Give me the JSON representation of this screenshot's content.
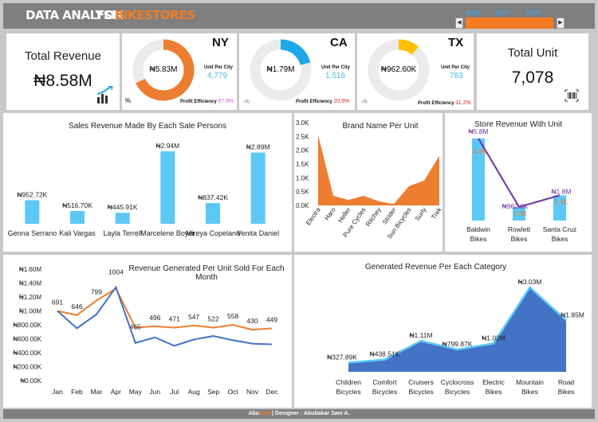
{
  "header": {
    "title_part1": "DATA ANALYSIS",
    "title_part2": "FOR",
    "title_part3": "BIKESTORES"
  },
  "year_slicer": {
    "years": [
      "2016",
      "2017",
      "2018"
    ]
  },
  "kpis": {
    "total_revenue": {
      "label": "Total Revenue",
      "value": "₦8.58M"
    },
    "total_unit": {
      "label": "Total Unit",
      "value": "7,078"
    }
  },
  "cities": [
    {
      "name": "NY",
      "revenue": "₦5.83M",
      "unit_label": "Unit Per City",
      "units": "4,779",
      "efficiency_label": "Profit Efficiency",
      "efficiency": "67.9%",
      "efficiency_color": "#e05be0",
      "ring_color": "#ed7d31",
      "ring_fraction": 0.679
    },
    {
      "name": "CA",
      "revenue": "₦1.79M",
      "unit_label": "Unit Per City",
      "units": "1,516",
      "efficiency_label": "Profit Efficiency",
      "efficiency": "20.9%",
      "efficiency_color": "#e02020",
      "ring_color": "#1ea7e8",
      "ring_fraction": 0.209
    },
    {
      "name": "TX",
      "revenue": "₦962.60K",
      "unit_label": "Unit Per City",
      "units": "783",
      "efficiency_label": "Profit Efficiency",
      "efficiency": "11.2%",
      "efficiency_color": "#e02020",
      "ring_color": "#ffc000",
      "ring_fraction": 0.112
    }
  ],
  "colors": {
    "orange": "#ed7d31",
    "lightblue": "#5bc8f5",
    "blue": "#4472c4",
    "purple": "#7030a0",
    "header": "#7f7f7f"
  },
  "chart_data": [
    {
      "type": "bar",
      "title": "Sales Revenue Made By Each Sale Persons",
      "categories": [
        "Genna Serrano",
        "Kali Vargas",
        "Layla Terrell",
        "Marcelene Boyer",
        "Mireya Copeland",
        "Venita Daniel"
      ],
      "values": [
        952720,
        516700,
        445910,
        2940000,
        837420,
        2890000
      ],
      "data_labels": [
        "₦952.72K",
        "₦516.70K",
        "₦445.91K",
        "₦2.94M",
        "₦837.42K",
        "₦2.89M"
      ],
      "ylim": [
        0,
        3200000
      ]
    },
    {
      "type": "area",
      "title": "Brand Name Per Unit",
      "categories": [
        "Electra",
        "Haro",
        "Heller",
        "Pure Cycles",
        "Ritchey",
        "Strider",
        "Sun Bicycles",
        "Surly",
        "Trek"
      ],
      "values": [
        2.55,
        0.35,
        0.2,
        0.35,
        0.15,
        0.05,
        0.7,
        0.9,
        1.8
      ],
      "yticks": [
        "3.0K",
        "2.5K",
        "2.0K",
        "1.5K",
        "1.0K",
        "0.5K",
        "0.0K"
      ],
      "ylim": [
        0,
        3.0
      ]
    },
    {
      "type": "bar",
      "title": "Store Revenue With Unit",
      "categories": [
        "Baldwin Bikes",
        "Rowlett Bikes",
        "Santa Cruz Bikes"
      ],
      "series": [
        {
          "values": [
            5.83,
            0.9626,
            1.79
          ],
          "data_labels": [
            "₦5.8M",
            "₦962.6K",
            "₦1.8M"
          ]
        },
        {
          "values": [
            4.8,
            0.8,
            1.5
          ],
          "data_labels": [
            "4.8K",
            "0.8K",
            "1.5K"
          ]
        }
      ],
      "ylim": [
        0,
        6.5
      ]
    },
    {
      "type": "line",
      "title": "Revenue Generated  Per Unit Sold For Each Month",
      "categories": [
        "Jan",
        "Feb",
        "Mar",
        "Apr",
        "May",
        "Jun",
        "Jul",
        "Aug",
        "Sep",
        "Oct",
        "Nov",
        "Dec"
      ],
      "series": [
        {
          "values": [
            691,
            646,
            799,
            1004,
            465,
            496,
            471,
            547,
            522,
            558,
            430,
            449
          ],
          "data_labels": [
            "691",
            "646",
            "799",
            "1004",
            "465",
            "496",
            "471",
            "547",
            "522",
            "558",
            "430",
            "449"
          ]
        },
        {
          "values": [
            1000000,
            750000,
            950000,
            1340000,
            540000,
            620000,
            500000,
            590000,
            640000,
            580000,
            530000,
            520000
          ]
        }
      ],
      "secondary_axis_values": [
        1000000,
        940000,
        1150000,
        1320000,
        760000,
        780000,
        760000,
        790000,
        760000,
        800000,
        730000,
        750000
      ],
      "yticks": [
        "₦1.60M",
        "₦1.40M",
        "₦1.20M",
        "₦1.00M",
        "₦800.00K",
        "₦600.00K",
        "₦400.00K",
        "₦200.00K",
        "₦0.00K"
      ],
      "ylim": [
        0,
        1600000
      ]
    },
    {
      "type": "area",
      "title": "Generated Revenue Per Each Category",
      "categories": [
        "Children Bicycles",
        "Comfort Bicycles",
        "Cruisers Bicycles",
        "Cyclocross Bicycles",
        "Electric Bikes",
        "Mountain Bikes",
        "Road Bikes"
      ],
      "values": [
        327890,
        438510,
        1110000,
        799870,
        1020000,
        3030000,
        1850000
      ],
      "data_labels": [
        "₦327.89K",
        "₦438.51K",
        "₦1.11M",
        "₦799.87K",
        "₦1.02M",
        "₦3.03M",
        "₦1.85M"
      ],
      "ylim": [
        0,
        3200000
      ]
    }
  ],
  "footer": {
    "prefix": "Abu",
    "accent": "sani",
    "text": " | Designer : Abubakar Sani A."
  }
}
